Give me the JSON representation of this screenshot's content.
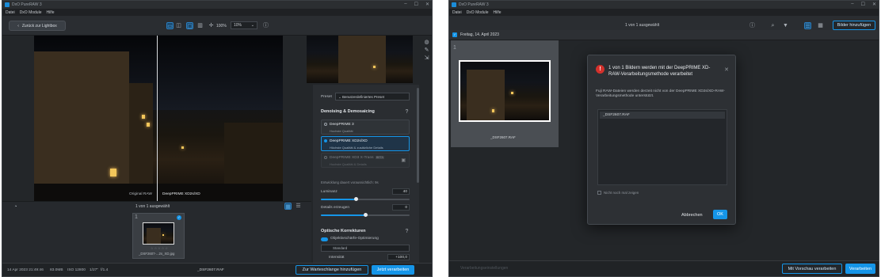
{
  "left": {
    "app_title": "DxO PureRAW 3",
    "menu": [
      "Datei",
      "DxO Module",
      "Hilfe"
    ],
    "back_button": "Zurück zur Lightbox",
    "zoom_percent": "100%",
    "zoom_select": "10%",
    "before_label": "Original RAW",
    "after_label": "DeepPRIME XD2s/XD",
    "selection_count": "1 von 1 ausgewählt",
    "thumb_number": "1",
    "thumb_filename": "_DSF2607-...2s_XD.jpg",
    "preset_label": "Preset",
    "preset_value": "Benutzerdefiniertes Preset",
    "denoise_title": "Denoising & Demosaicing",
    "options": [
      {
        "title": "DeepPRIME 3",
        "sub": "Hochste Qualität"
      },
      {
        "title": "DeepPRIME XD2s/XD",
        "sub": "Höchste Qualität & zusätzliche Details"
      },
      {
        "title": "DeepPRIME XD3 X-Trans",
        "badge": "BETA",
        "sub": "Hochste Qualität & Details"
      }
    ],
    "duration": "Entwicklung dauert voraussichtlich: 9s",
    "luminance_label": "Luminanz",
    "luminance_value": "40",
    "luminance_level": 0.4,
    "details_label": "Details erzeugen",
    "details_value": "0",
    "details_level": 0.5,
    "optics_title": "Optische Korrekturen",
    "sharpness_label": "Objektivschärfe-Optimierung",
    "sharpness_value": "Standard",
    "intensity_label": "Intensität",
    "intensity_value": "+100,0",
    "status_date": "14 Apr 2023 21:49:46",
    "status_size": "83.0MB",
    "status_iso": "ISO 12800",
    "status_shutter": "1/27\"",
    "status_aperture": "f/1.4",
    "status_filename": "_DSF2607.RAF",
    "queue_button": "Zur Warteschlange hinzufügen",
    "process_button": "Jetzt verarbeiten"
  },
  "right": {
    "app_title": "DxO PureRAW 3",
    "menu": [
      "Datei",
      "DxO Module",
      "Hilfe"
    ],
    "selection_count": "1 von 1 ausgewählt",
    "add_images_button": "Bilder hinzufügen",
    "date_header": "Freitag, 14. April 2023",
    "thumb_number": "1",
    "thumb_filename": "_DSF2607.RAF",
    "dialog_title": "1 von 1 Bildern werden mit der DeepPRIME XD-RAW-Verarbeitungsmethode verarbeitet",
    "dialog_body": "Fuji RAW-Dateien werden derzeit nicht von der DeepPRIME XD2s/XD-RAW-Verarbeitungsmethode unterstützt.",
    "dialog_file": "_DSF2607.RAF",
    "dont_show": "Nicht noch mal zeigen",
    "cancel_button": "Abbrechen",
    "ok_button": "OK",
    "process_settings_button": "Verarbeitungseinstellungen",
    "preview_process_button": "Mit Vorschau verarbeiten",
    "process_button": "Verarbeiten"
  }
}
